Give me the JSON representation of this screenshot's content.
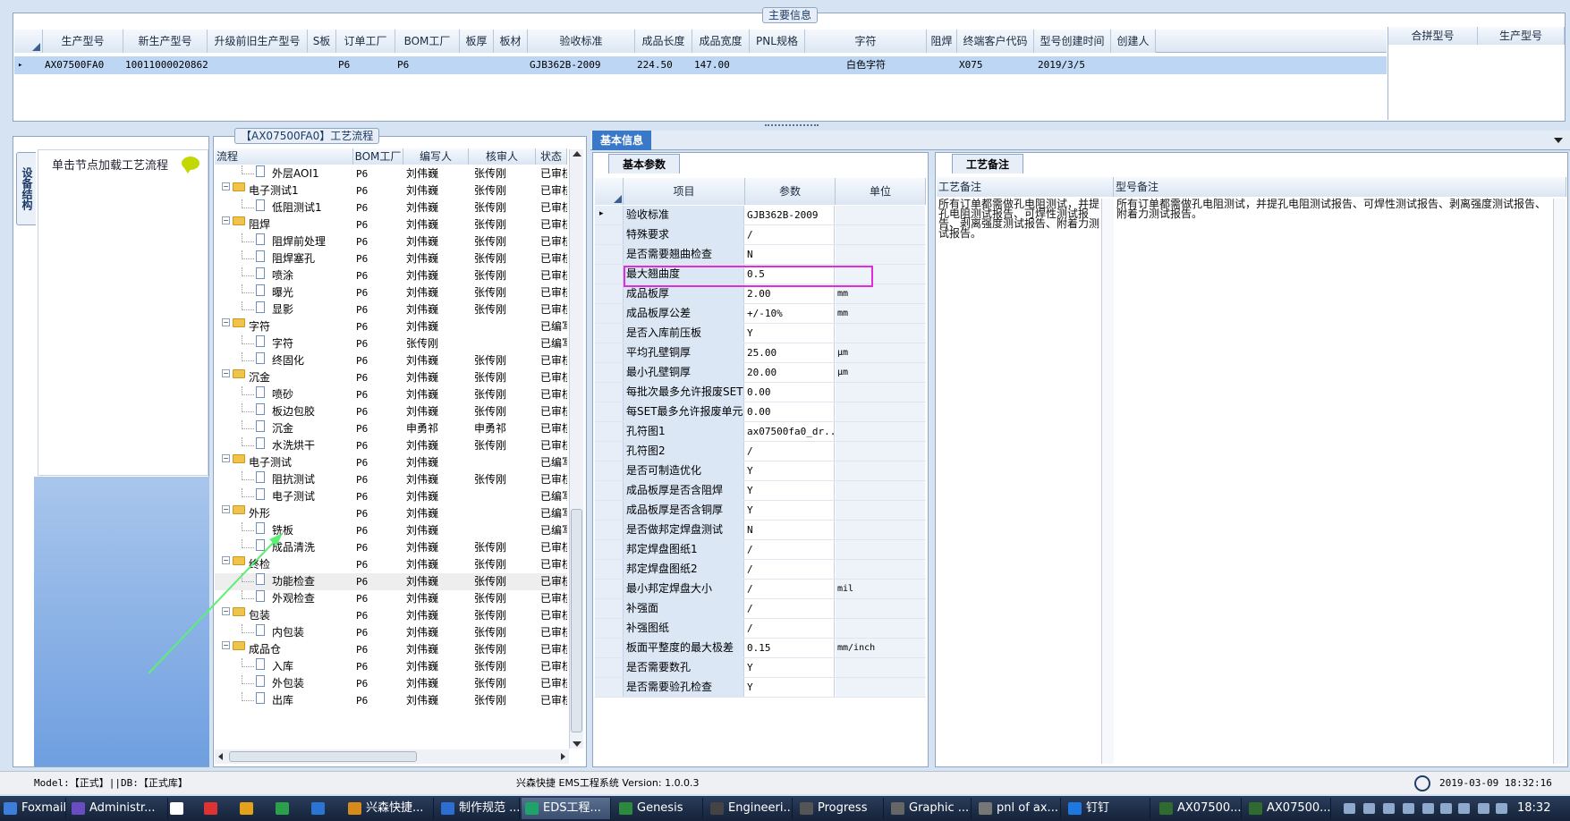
{
  "main_info": {
    "title": "主要信息",
    "columns": [
      "生产型号",
      "新生产型号",
      "升级前旧生产型号",
      "S板",
      "订单工厂",
      "BOM工厂",
      "板厚",
      "板材",
      "验收标准",
      "成品长度",
      "成品宽度",
      "PNL规格",
      "字符",
      "阻焊",
      "终端客户代码",
      "型号创建时间",
      "创建人"
    ],
    "row": {
      "生产型号": "AX07500FA0",
      "新生产型号": "10011000020862",
      "订单工厂": "P6",
      "BOM工厂": "P6",
      "验收标准": "GJB362B-2009",
      "成品长度": "224.50",
      "成品宽度": "147.00",
      "字符": "白色字符",
      "终端客户代码": "X075",
      "型号创建时间": "2019/3/5"
    },
    "side_columns": [
      "合拼型号",
      "生产型号"
    ]
  },
  "left_panel": {
    "vertical_tab": "设备结构",
    "hint": "单击节点加载工艺流程"
  },
  "process_flow": {
    "title": "【AX07500FA0】工艺流程",
    "columns": [
      "流程",
      "BOM工厂",
      "编写人",
      "核审人",
      "状态"
    ],
    "rows": [
      {
        "level": 1,
        "name": "外层AOI1",
        "bom": "P6",
        "writer": "刘伟巍",
        "reviewer": "张传刚",
        "status": "已审核"
      },
      {
        "level": 0,
        "name": "电子测试1",
        "bom": "P6",
        "writer": "刘伟巍",
        "reviewer": "张传刚",
        "status": "已审核"
      },
      {
        "level": 1,
        "name": "低阻测试1",
        "bom": "P6",
        "writer": "刘伟巍",
        "reviewer": "张传刚",
        "status": "已审核"
      },
      {
        "level": 0,
        "name": "阻焊",
        "bom": "P6",
        "writer": "刘伟巍",
        "reviewer": "张传刚",
        "status": "已审核"
      },
      {
        "level": 1,
        "name": "阻焊前处理",
        "bom": "P6",
        "writer": "刘伟巍",
        "reviewer": "张传刚",
        "status": "已审核"
      },
      {
        "level": 1,
        "name": "阻焊塞孔",
        "bom": "P6",
        "writer": "刘伟巍",
        "reviewer": "张传刚",
        "status": "已审核"
      },
      {
        "level": 1,
        "name": "喷涂",
        "bom": "P6",
        "writer": "刘伟巍",
        "reviewer": "张传刚",
        "status": "已审核"
      },
      {
        "level": 1,
        "name": "曝光",
        "bom": "P6",
        "writer": "刘伟巍",
        "reviewer": "张传刚",
        "status": "已审核"
      },
      {
        "level": 1,
        "name": "显影",
        "bom": "P6",
        "writer": "刘伟巍",
        "reviewer": "张传刚",
        "status": "已审核"
      },
      {
        "level": 0,
        "name": "字符",
        "bom": "P6",
        "writer": "刘伟巍",
        "reviewer": "",
        "status": "已编写"
      },
      {
        "level": 1,
        "name": "字符",
        "bom": "P6",
        "writer": "张传刚",
        "reviewer": "",
        "status": "已编写"
      },
      {
        "level": 1,
        "name": "终固化",
        "bom": "P6",
        "writer": "刘伟巍",
        "reviewer": "张传刚",
        "status": "已审核"
      },
      {
        "level": 0,
        "name": "沉金",
        "bom": "P6",
        "writer": "刘伟巍",
        "reviewer": "张传刚",
        "status": "已审核"
      },
      {
        "level": 1,
        "name": "喷砂",
        "bom": "P6",
        "writer": "刘伟巍",
        "reviewer": "张传刚",
        "status": "已审核"
      },
      {
        "level": 1,
        "name": "板边包胶",
        "bom": "P6",
        "writer": "刘伟巍",
        "reviewer": "张传刚",
        "status": "已审核"
      },
      {
        "level": 1,
        "name": "沉金",
        "bom": "P6",
        "writer": "申勇祁",
        "reviewer": "申勇祁",
        "status": "已审核"
      },
      {
        "level": 1,
        "name": "水洗烘干",
        "bom": "P6",
        "writer": "刘伟巍",
        "reviewer": "张传刚",
        "status": "已审核"
      },
      {
        "level": 0,
        "name": "电子测试",
        "bom": "P6",
        "writer": "刘伟巍",
        "reviewer": "",
        "status": "已编写"
      },
      {
        "level": 1,
        "name": "阻抗测试",
        "bom": "P6",
        "writer": "刘伟巍",
        "reviewer": "张传刚",
        "status": "已审核"
      },
      {
        "level": 1,
        "name": "电子测试",
        "bom": "P6",
        "writer": "刘伟巍",
        "reviewer": "",
        "status": "已编写"
      },
      {
        "level": 0,
        "name": "外形",
        "bom": "P6",
        "writer": "刘伟巍",
        "reviewer": "",
        "status": "已编写"
      },
      {
        "level": 1,
        "name": "铣板",
        "bom": "P6",
        "writer": "刘伟巍",
        "reviewer": "",
        "status": "已编写"
      },
      {
        "level": 1,
        "name": "成品清洗",
        "bom": "P6",
        "writer": "刘伟巍",
        "reviewer": "张传刚",
        "status": "已审核"
      },
      {
        "level": 0,
        "name": "终检",
        "bom": "P6",
        "writer": "刘伟巍",
        "reviewer": "张传刚",
        "status": "已审核"
      },
      {
        "level": 1,
        "name": "功能检查",
        "bom": "P6",
        "writer": "刘伟巍",
        "reviewer": "张传刚",
        "status": "已审核"
      },
      {
        "level": 1,
        "name": "外观检查",
        "bom": "P6",
        "writer": "刘伟巍",
        "reviewer": "张传刚",
        "status": "已审核"
      },
      {
        "level": 0,
        "name": "包装",
        "bom": "P6",
        "writer": "刘伟巍",
        "reviewer": "张传刚",
        "status": "已审核"
      },
      {
        "level": 1,
        "name": "内包装",
        "bom": "P6",
        "writer": "刘伟巍",
        "reviewer": "张传刚",
        "status": "已审核"
      },
      {
        "level": 0,
        "name": "成品仓",
        "bom": "P6",
        "writer": "刘伟巍",
        "reviewer": "张传刚",
        "status": "已审核"
      },
      {
        "level": 1,
        "name": "入库",
        "bom": "P6",
        "writer": "刘伟巍",
        "reviewer": "张传刚",
        "status": "已审核"
      },
      {
        "level": 1,
        "name": "外包装",
        "bom": "P6",
        "writer": "刘伟巍",
        "reviewer": "张传刚",
        "status": "已审核"
      },
      {
        "level": 1,
        "name": "出库",
        "bom": "P6",
        "writer": "刘伟巍",
        "reviewer": "张传刚",
        "status": "已审核"
      }
    ],
    "top_partial": {
      "name": "AOI",
      "bom": "P6",
      "writer": "刘伟巍",
      "reviewer": "张传刚",
      "status": "已审核"
    }
  },
  "basic_info": {
    "tab": "基本信息",
    "subtab": "基本参数",
    "columns": [
      "项目",
      "参数",
      "单位"
    ],
    "params": [
      {
        "k": "验收标准",
        "v": "GJB362B-2009",
        "u": ""
      },
      {
        "k": "特殊要求",
        "v": "/",
        "u": ""
      },
      {
        "k": "是否需要翘曲检查",
        "v": "N",
        "u": ""
      },
      {
        "k": "最大翘曲度",
        "v": "0.5",
        "u": ""
      },
      {
        "k": "成品板厚",
        "v": "2.00",
        "u": "mm"
      },
      {
        "k": "成品板厚公差",
        "v": "+/-10%",
        "u": "mm"
      },
      {
        "k": "是否入库前压板",
        "v": "Y",
        "u": ""
      },
      {
        "k": "平均孔壁铜厚",
        "v": "25.00",
        "u": "μm"
      },
      {
        "k": "最小孔壁铜厚",
        "v": "20.00",
        "u": "μm"
      },
      {
        "k": "每批次最多允许报废SET",
        "v": "0.00",
        "u": ""
      },
      {
        "k": "每SET最多允许报废单元",
        "v": "0.00",
        "u": ""
      },
      {
        "k": "孔符图1",
        "v": "ax07500fa0_dr...",
        "u": ""
      },
      {
        "k": "孔符图2",
        "v": "/",
        "u": ""
      },
      {
        "k": "是否可制造优化",
        "v": "Y",
        "u": ""
      },
      {
        "k": "成品板厚是否含阻焊",
        "v": "Y",
        "u": ""
      },
      {
        "k": "成品板厚是否含铜厚",
        "v": "Y",
        "u": ""
      },
      {
        "k": "是否做邦定焊盘测试",
        "v": "N",
        "u": ""
      },
      {
        "k": "邦定焊盘图纸1",
        "v": "/",
        "u": ""
      },
      {
        "k": "邦定焊盘图纸2",
        "v": "/",
        "u": ""
      },
      {
        "k": "最小邦定焊盘大小",
        "v": "/",
        "u": "mil"
      },
      {
        "k": "补强面",
        "v": "/",
        "u": ""
      },
      {
        "k": "补强图纸",
        "v": "/",
        "u": ""
      },
      {
        "k": "板面平整度的最大极差",
        "v": "0.15",
        "u": "mm/inch"
      },
      {
        "k": "是否需要数孔",
        "v": "Y",
        "u": ""
      },
      {
        "k": "是否需要验孔检查",
        "v": "Y",
        "u": ""
      }
    ]
  },
  "process_notes": {
    "tab": "工艺备注",
    "col1": "工艺备注",
    "col2": "型号备注",
    "text1": "所有订单都需做孔电阻测试，并提孔电阻测试报告、可焊性测试报告、剥离强度测试报告、附着力测试报告。",
    "text2": "所有订单都需做孔电阻测试，并提孔电阻测试报告、可焊性测试报告、剥离强度测试报告、附着力测试报告。"
  },
  "status_bar": {
    "model": "Model:【正式】||DB:【正式库】",
    "system": "兴森快捷 EMS工程系统 Version: 1.0.0.3",
    "datetime": "2019-03-09 18:32:16"
  },
  "taskbar": {
    "items": [
      "Foxmail",
      "Administr...",
      "兴森快捷...",
      "制作规范 ...",
      "EDS工程...",
      "Genesis",
      "Engineeri...",
      "Progress",
      "Graphic ...",
      "pnl of ax...",
      "钉钉",
      "AX07500...",
      "AX07500..."
    ],
    "clock": "18:32"
  }
}
